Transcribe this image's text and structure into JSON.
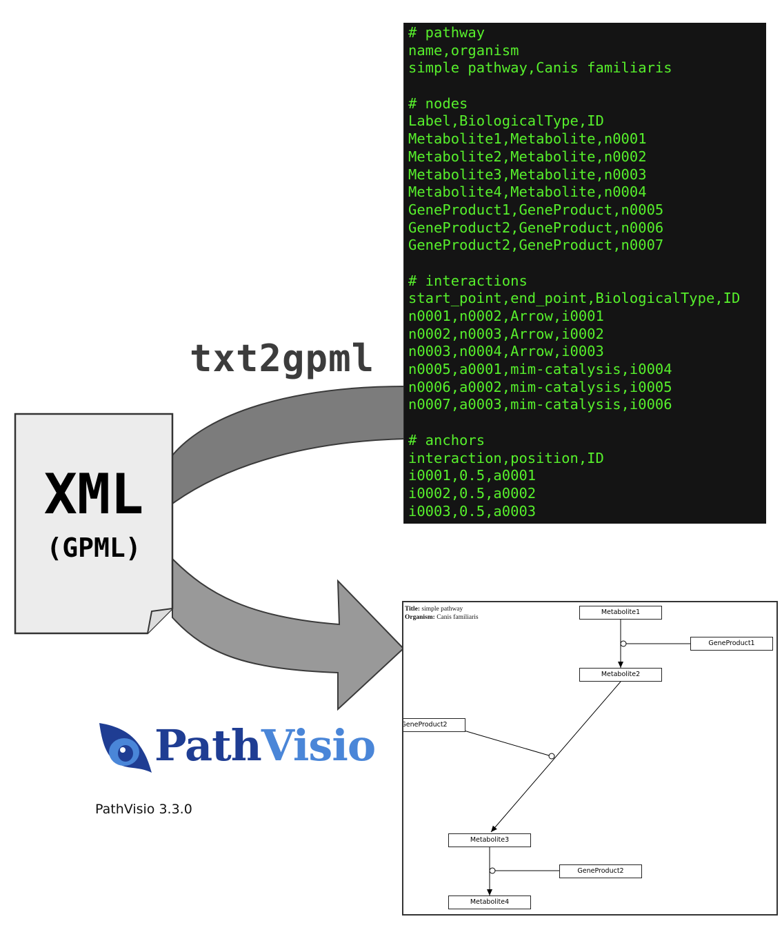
{
  "tool_label": "txt2gpml",
  "terminal_lines": [
    "# pathway",
    "name,organism",
    "simple pathway,Canis familiaris",
    "",
    "# nodes",
    "Label,BiologicalType,ID",
    "Metabolite1,Metabolite,n0001",
    "Metabolite2,Metabolite,n0002",
    "Metabolite3,Metabolite,n0003",
    "Metabolite4,Metabolite,n0004",
    "GeneProduct1,GeneProduct,n0005",
    "GeneProduct2,GeneProduct,n0006",
    "GeneProduct2,GeneProduct,n0007",
    "",
    "# interactions",
    "start_point,end_point,BiologicalType,ID",
    "n0001,n0002,Arrow,i0001",
    "n0002,n0003,Arrow,i0002",
    "n0003,n0004,Arrow,i0003",
    "n0005,a0001,mim-catalysis,i0004",
    "n0006,a0002,mim-catalysis,i0005",
    "n0007,a0003,mim-catalysis,i0006",
    "",
    "# anchors",
    "interaction,position,ID",
    "i0001,0.5,a0001",
    "i0002,0.5,a0002",
    "i0003,0.5,a0003"
  ],
  "xml_doc": {
    "title": "XML",
    "subtitle": "(GPML)"
  },
  "logo": {
    "part1": "Path",
    "part2": "Visio",
    "color_dark": "#1f3d93",
    "color_light": "#4a86d8"
  },
  "version": "PathVisio 3.3.0",
  "pathway": {
    "title_label": "Title:",
    "title_value": "simple pathway",
    "organism_label": "Organism:",
    "organism_value": "Canis familiaris",
    "nodes": {
      "metabolite1": "Metabolite1",
      "metabolite2": "Metabolite2",
      "metabolite3": "Metabolite3",
      "metabolite4": "Metabolite4",
      "geneproduct1": "GeneProduct1",
      "geneproduct2a": "GeneProduct2",
      "geneproduct2b": "GeneProduct2"
    }
  },
  "colors": {
    "terminal_bg": "#141414",
    "terminal_text": "#57f02c",
    "arrow_fill": "#8c8c8c",
    "doc_fill": "#ececec"
  }
}
